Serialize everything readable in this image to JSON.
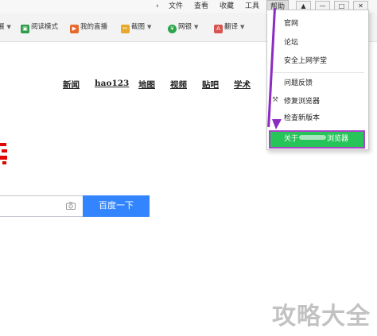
{
  "menubar": {
    "items": [
      "文件",
      "查看",
      "收藏",
      "工具",
      "帮助"
    ],
    "active": "帮助",
    "window_buttons": [
      "skin-icon",
      "minimize-icon",
      "restore-icon",
      "close-icon"
    ]
  },
  "toolbar": {
    "items": [
      {
        "label": "展",
        "icon": "expand-icon"
      },
      {
        "label": "阅读模式",
        "icon": "reading-mode-icon"
      },
      {
        "label": "我的直播",
        "icon": "live-icon"
      },
      {
        "label": "截图",
        "icon": "screenshot-icon"
      },
      {
        "label": "网银",
        "icon": "ebank-icon"
      },
      {
        "label": "翻译",
        "icon": "translate-icon"
      }
    ]
  },
  "nav": {
    "links": [
      "新闻",
      "hao123",
      "地图",
      "视频",
      "贴吧",
      "学术"
    ]
  },
  "search": {
    "button_label": "百度一下"
  },
  "help_menu": {
    "items": [
      "官网",
      "论坛",
      "安全上网学堂",
      "问题反馈",
      "修复浏览器",
      "检查新版本"
    ],
    "highlighted_prefix": "关于",
    "highlighted_suffix": "浏览器"
  },
  "watermark": "攻略大全",
  "colors": {
    "search_button": "#3385ff",
    "highlight_green": "#27c45a",
    "annotation_purple": "#a845c8",
    "logo_red": "#e10601"
  }
}
